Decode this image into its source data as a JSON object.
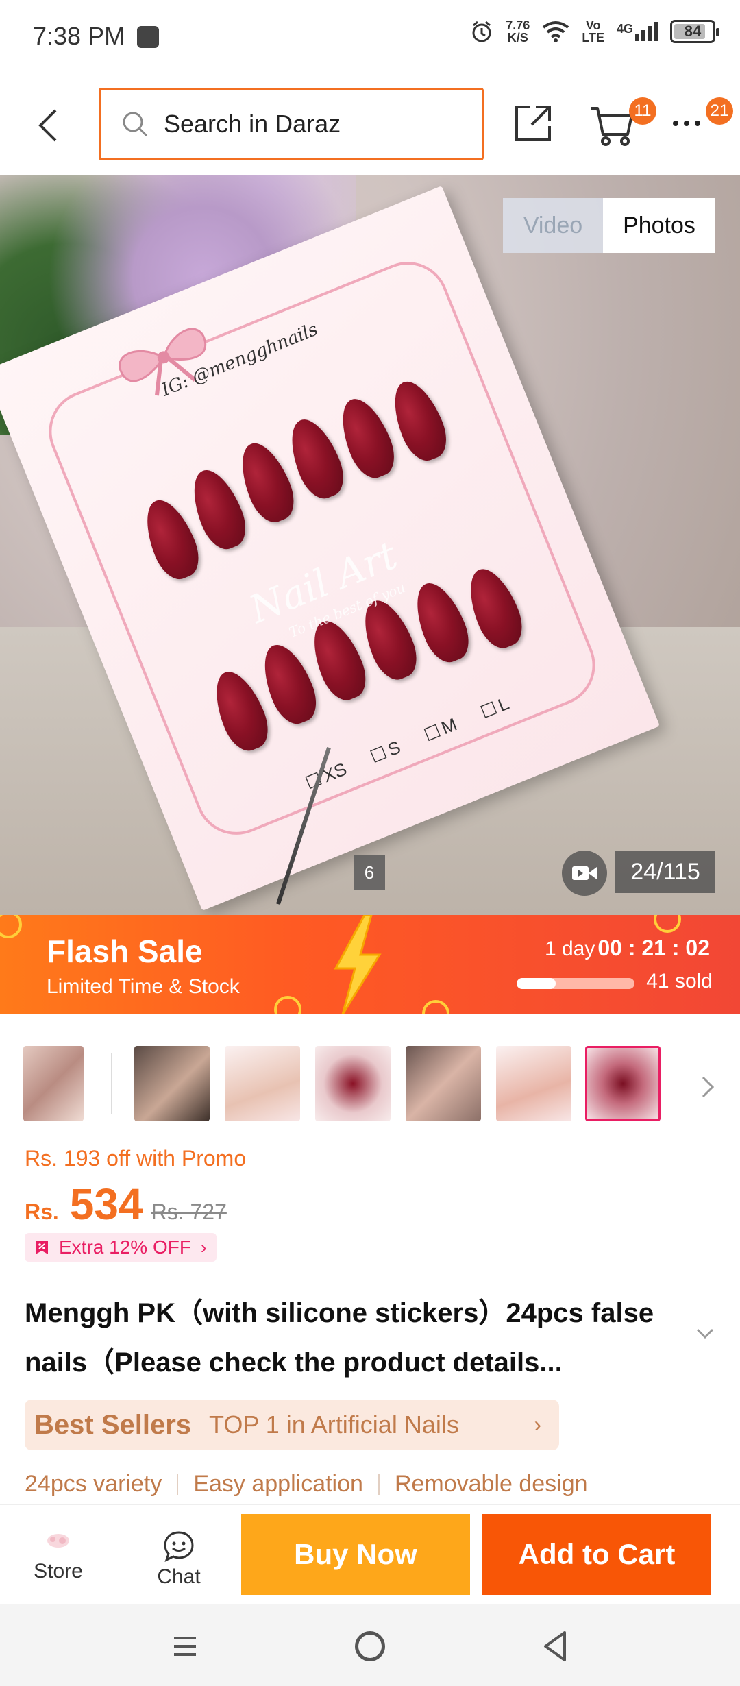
{
  "status_bar": {
    "time": "7:38 PM",
    "net_speed": "7.76",
    "net_unit": "K/S",
    "volte_top": "Vo",
    "volte_bottom": "LTE",
    "network": "4G",
    "battery": "84",
    "battery_level": 0.84
  },
  "header": {
    "search_placeholder": "Search in Daraz",
    "cart_badge": "11",
    "more_badge": "21"
  },
  "gallery": {
    "toggle_video": "Video",
    "toggle_photos": "Photos",
    "image_badge": "6",
    "counter": "24/115",
    "product_image": {
      "handle": "IG: @mengghnails",
      "brand_text": "Nail Art",
      "brand_sub": "To the best of you",
      "sizes": [
        "XS",
        "S",
        "M",
        "L"
      ]
    }
  },
  "flash_sale": {
    "title": "Flash Sale",
    "subtitle": "Limited Time & Stock",
    "days": "1 day",
    "clock": "00 : 21 : 02",
    "sold": "41 sold",
    "progress": 0.33
  },
  "thumbnails": {
    "count": 7,
    "selected_index": 6
  },
  "price": {
    "promo": "Rs. 193 off with Promo",
    "currency": "Rs.",
    "value": "534",
    "original": "Rs. 727",
    "extra_off": "Extra 12% OFF"
  },
  "product": {
    "title": "Menggh PK（with silicone stickers）24pcs false nails（Please check the product details..."
  },
  "best_sellers": {
    "label": "Best Sellers",
    "rank_text": "TOP 1 in Artificial Nails"
  },
  "features": [
    "24pcs variety",
    "Easy application",
    "Removable design"
  ],
  "action_bar": {
    "store_label": "Store",
    "chat_label": "Chat",
    "buy_now": "Buy Now",
    "add_to_cart": "Add to Cart"
  },
  "colors": {
    "accent": "#f36f21",
    "buy_now": "#fea71a",
    "add_to_cart": "#f85606",
    "best_seller_text": "#c07a4a",
    "extra_off": "#e91e63"
  },
  "icons": [
    "back-arrow-icon",
    "search-icon",
    "share-icon",
    "cart-icon",
    "more-icon",
    "video-camera-icon",
    "chevron-right-icon",
    "voucher-tag-icon",
    "chevron-down-icon",
    "store-icon",
    "chat-icon",
    "nav-menu-icon",
    "nav-home-icon",
    "nav-back-icon"
  ]
}
